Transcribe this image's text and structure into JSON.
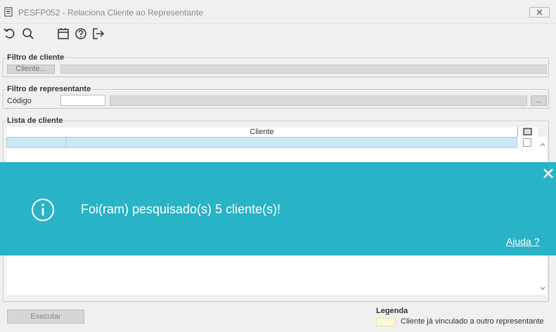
{
  "window": {
    "title": "PESFP052 - Relaciona Cliente ao Representante"
  },
  "toolbar": {
    "icons": [
      "undo-icon",
      "search-icon",
      "calendar-icon",
      "help-icon",
      "exit-icon"
    ]
  },
  "client_filter": {
    "legend": "Filtro de cliente",
    "button_label": "Cliente..."
  },
  "rep_filter": {
    "legend": "Filtro de representante",
    "code_label": "Código",
    "code_value": "",
    "search_button_label": "..."
  },
  "client_list": {
    "legend": "Lista de cliente",
    "column_header": "Cliente"
  },
  "notification": {
    "message": "Foi(ram) pesquisado(s) 5 cliente(s)!",
    "help_link": "Ajuda ?",
    "color": "#29b3c6"
  },
  "actions": {
    "execute_label": "Executar"
  },
  "legend_box": {
    "title": "Legenda",
    "item_label": "Cliente já vinculado a outro representante",
    "item_color": "#fbf8d6"
  }
}
